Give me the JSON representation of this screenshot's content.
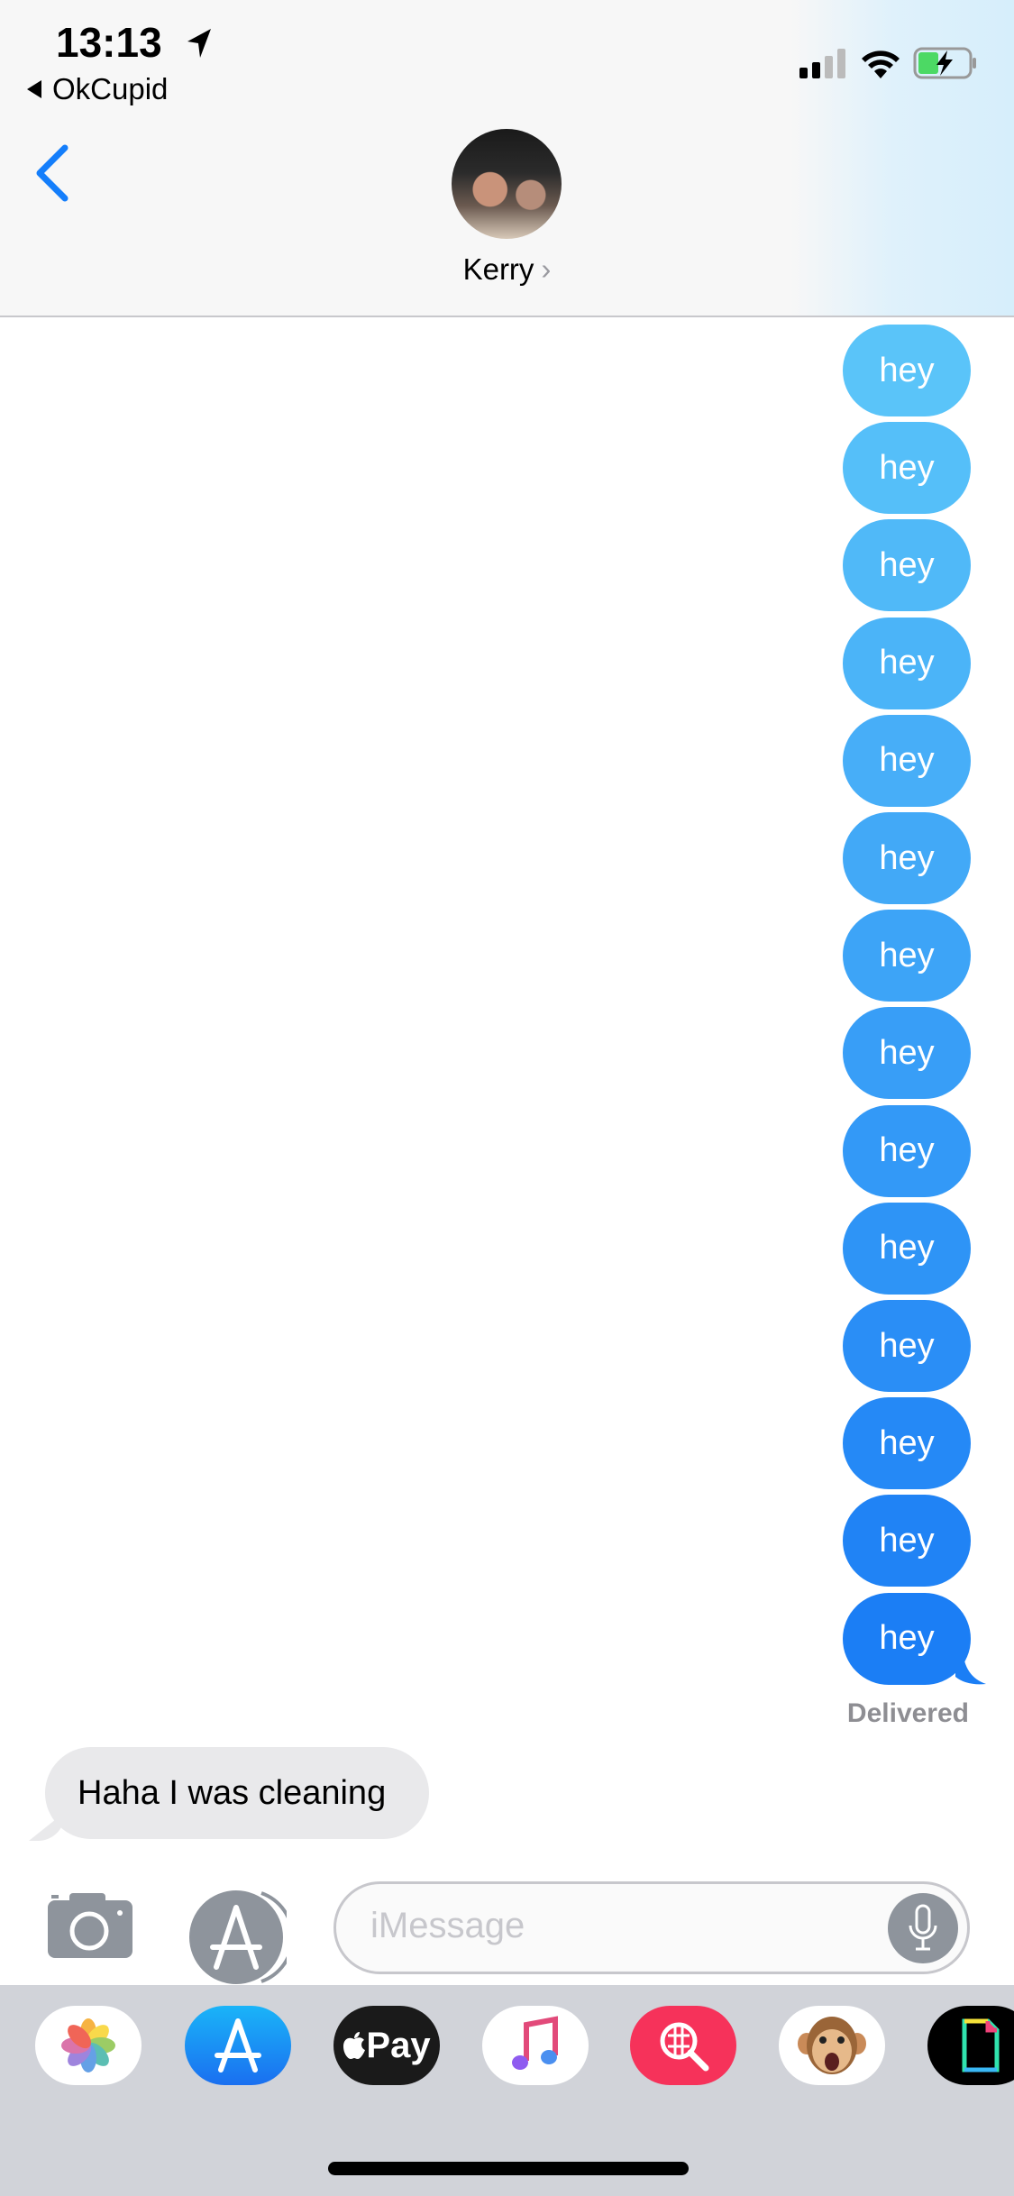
{
  "status_bar": {
    "time": "13:13",
    "back_app": "OkCupid",
    "battery_charging": true
  },
  "header": {
    "contact_name": "Kerry",
    "chevron": "›"
  },
  "colors": {
    "bubble_top": "#5ac4f9",
    "bubble_bottom": "#1b7ef5",
    "received_bubble": "#e9e9eb",
    "accent": "#147efb"
  },
  "messages": {
    "sent": [
      "hey",
      "hey",
      "hey",
      "hey",
      "hey",
      "hey",
      "hey",
      "hey",
      "hey",
      "hey",
      "hey",
      "hey",
      "hey",
      "hey"
    ],
    "delivered_label": "Delivered",
    "received": "Haha I was cleaning"
  },
  "input": {
    "placeholder": "iMessage"
  },
  "app_drawer": {
    "apps": [
      "photos-icon",
      "app-store-icon",
      "apple-pay-icon",
      "music-icon",
      "web-search-icon",
      "animoji-icon",
      "gif-icon"
    ],
    "apple_pay_label": "Pay"
  }
}
